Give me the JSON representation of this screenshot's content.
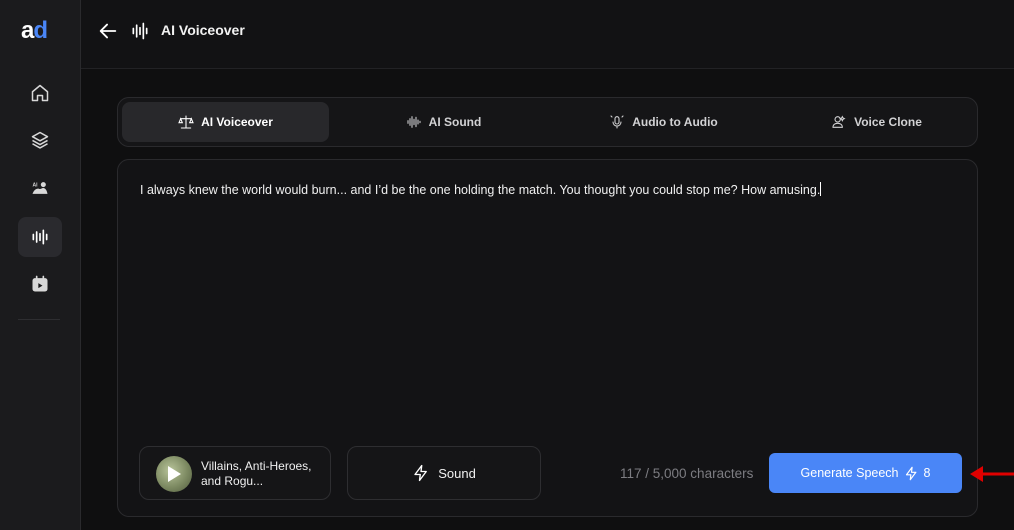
{
  "app": {
    "logo_a": "a",
    "logo_d": "d",
    "brand_color": "#4a86f7"
  },
  "sidebar": {
    "items": [
      {
        "name": "home-icon",
        "active": false
      },
      {
        "name": "layers-icon",
        "active": false
      },
      {
        "name": "ai-image-icon",
        "active": false
      },
      {
        "name": "audio-waveform-icon",
        "active": true
      },
      {
        "name": "video-calendar-icon",
        "active": false
      }
    ]
  },
  "header": {
    "title": "AI Voiceover"
  },
  "tabs": [
    {
      "label": "AI Voiceover",
      "icon": "balance-icon",
      "active": true
    },
    {
      "label": "AI Sound",
      "icon": "sound-wave-icon",
      "active": false
    },
    {
      "label": "Audio to Audio",
      "icon": "mic-sparkle-icon",
      "active": false
    },
    {
      "label": "Voice Clone",
      "icon": "user-clone-icon",
      "active": false
    }
  ],
  "editor": {
    "text": "I always knew the world would burn... and I’d be the one holding the match. You thought you could stop me? How amusing."
  },
  "controls": {
    "voice_name": "Villains, Anti-Heroes, and Rogu...",
    "sound_label": "Sound",
    "char_count": "117 / 5,000 characters",
    "generate_label": "Generate Speech",
    "generate_cost": "8"
  },
  "colors": {
    "accent": "#4a86f7",
    "annotation_arrow": "#e00000"
  }
}
